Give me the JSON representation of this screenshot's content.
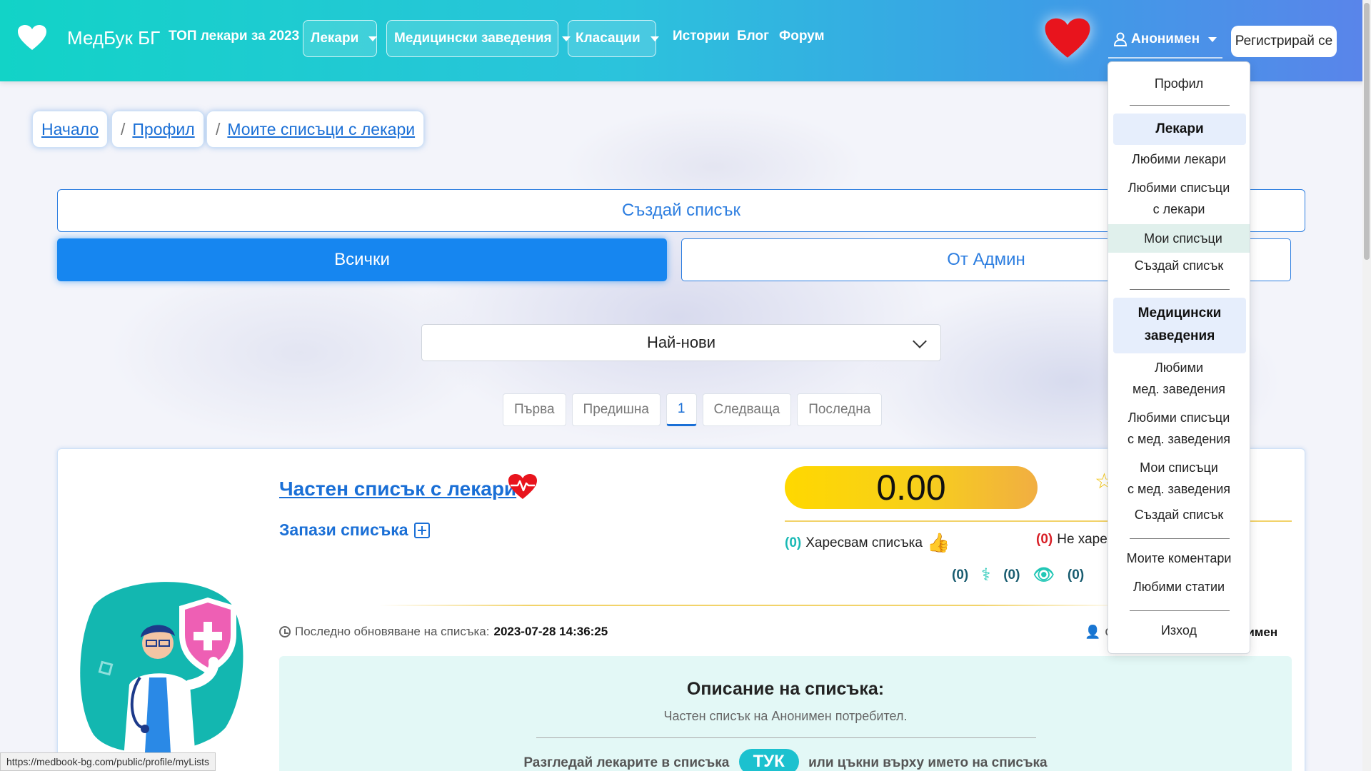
{
  "navbar": {
    "brand": "МедБук БГ",
    "top_doctors": "ТОП лекари за 2023",
    "dd_doctors": "Лекари",
    "dd_facilities": "Медицински заведения",
    "dd_rankings": "Класации",
    "stories": "Истории",
    "blog": "Блог",
    "forum": "Форум",
    "user": "Анонимен",
    "register": "Регистрирай се"
  },
  "breadcrumb": {
    "home": "Начало",
    "profile": "Профил",
    "current": "Моите списъци с лекари",
    "separator": "/"
  },
  "actions": {
    "create_list": "Създай списък",
    "tab_all": "Всички",
    "tab_admin": "От Админ",
    "sort_selected": "Най-нови"
  },
  "pagination": {
    "first": "Първа",
    "prev": "Предишна",
    "page": "1",
    "next": "Следваща",
    "last": "Последна"
  },
  "card": {
    "title": "Частен списък с лекари",
    "save": "Запази списъка",
    "score": "0.00",
    "like_count": "(0)",
    "like_label": "Харесвам списъка",
    "dislike_count": "(0)",
    "dislike_label": "Не харес",
    "stat1": "(0)",
    "stat2": "(0)",
    "stat3": "(0)",
    "updated_label": "Последно обновяване на списъка:",
    "updated_value": "2023-07-28 14:36:25",
    "author_prefix": "С",
    "author_name": "онимен",
    "desc_title": "Описание на списъка:",
    "desc_text": "Частен списък на Анонимен потребител.",
    "cta_before": "Разгледай лекарите в списъка",
    "cta_button": "ТУК",
    "cta_after": "или цъкни върху името на списъка"
  },
  "menu": {
    "profile": "Профил",
    "doctors_head": "Лекари",
    "fav_doctors": "Любими лекари",
    "fav_lists_1": "Любими списъци",
    "fav_lists_2": "с лекари",
    "my_lists": "Мои списъци",
    "create_list": "Създай списък",
    "facilities_head_1": "Медицински",
    "facilities_head_2": "заведения",
    "fav_fac_1": "Любими",
    "fav_fac_2": "мед. заведения",
    "fav_fac_lists_1": "Любими списъци",
    "fav_fac_lists_2": "с мед. заведения",
    "my_fac_lists_1": "Мои списъци",
    "my_fac_lists_2": "с мед. заведения",
    "create_list_2": "Създай списък",
    "my_comments": "Моите коментари",
    "fav_articles": "Любими статии",
    "logout": "Изход"
  },
  "status_url": "https://medbook-bg.com/public/profile/myLists",
  "colors": {
    "accent": "#1686f0",
    "link": "#1a6fd6",
    "heart": "#e8141d",
    "teal": "#19b9b5"
  }
}
